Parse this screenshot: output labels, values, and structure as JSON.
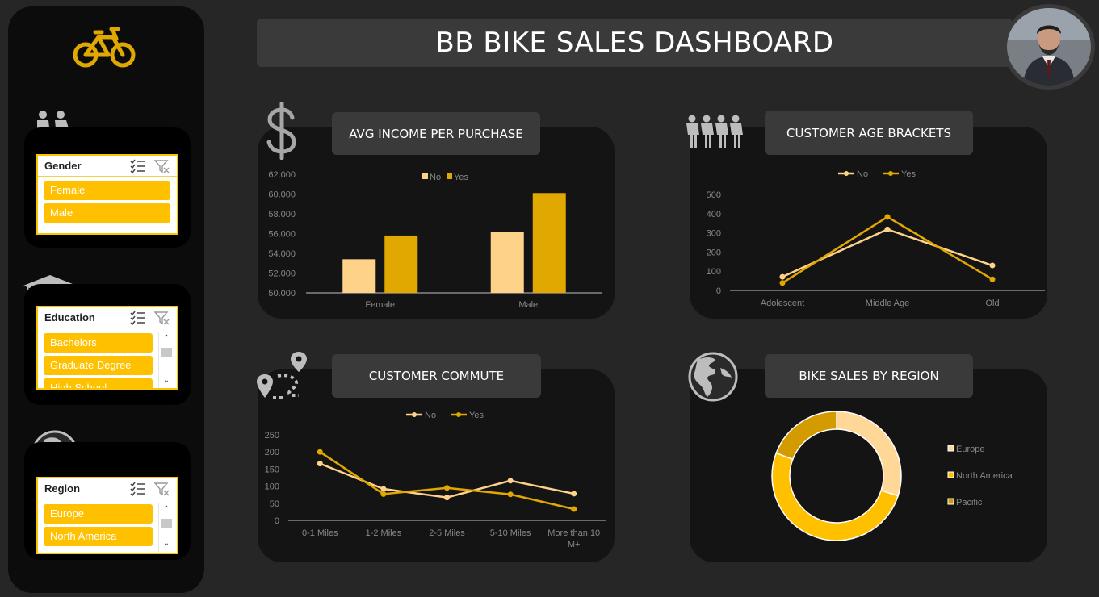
{
  "dashboard": {
    "title": "BB BIKE SALES DASHBOARD"
  },
  "icons": {
    "logo": "bicycle-icon",
    "gender": "people-couple-icon",
    "education": "graduation-cap-icon",
    "region": "globe-africa-icon",
    "income": "dollar-icon",
    "age": "group-people-icon",
    "commute": "route-pins-icon",
    "region_chart": "globe-americas-icon",
    "multi_select": "multi-select-icon",
    "clear_filter": "clear-filter-icon",
    "avatar": "user-avatar"
  },
  "colors": {
    "accent": "#ffc000",
    "no_series": "#ffd28a",
    "yes_series": "#e0a800",
    "background": "#262626",
    "panel": "#141414"
  },
  "slicers": {
    "gender": {
      "header": "Gender",
      "items": [
        "Female",
        "Male"
      ]
    },
    "education": {
      "header": "Education",
      "items": [
        "Bachelors",
        "Graduate Degree",
        "High School"
      ]
    },
    "region": {
      "header": "Region",
      "items": [
        "Europe",
        "North America"
      ]
    }
  },
  "chart_data": [
    {
      "type": "bar",
      "title": "AVG INCOME PER PURCHASE",
      "categories": [
        "Female",
        "Male"
      ],
      "series": [
        {
          "name": "No",
          "values": [
            53400,
            56200
          ]
        },
        {
          "name": "Yes",
          "values": [
            55800,
            60100
          ]
        }
      ],
      "ylim": [
        50000,
        62000
      ],
      "yticks": [
        "50.000",
        "52.000",
        "54.000",
        "56.000",
        "58.000",
        "60.000",
        "62.000"
      ],
      "legend": "top",
      "grid": false
    },
    {
      "type": "line",
      "title": "CUSTOMER AGE BRACKETS",
      "categories": [
        "Adolescent",
        "Middle Age",
        "Old"
      ],
      "series": [
        {
          "name": "No",
          "values": [
            71,
            318,
            130
          ]
        },
        {
          "name": "Yes",
          "values": [
            39,
            383,
            58
          ]
        }
      ],
      "ylim": [
        0,
        500
      ],
      "yticks": [
        "0",
        "100",
        "200",
        "300",
        "400",
        "500"
      ],
      "legend": "top",
      "grid": false
    },
    {
      "type": "line",
      "title": "CUSTOMER COMMUTE",
      "categories": [
        "0-1 Miles",
        "1-2 Miles",
        "2-5 Miles",
        "5-10 Miles",
        "More than 10 M+"
      ],
      "series": [
        {
          "name": "No",
          "values": [
            166,
            92,
            67,
            116,
            78
          ]
        },
        {
          "name": "Yes",
          "values": [
            200,
            77,
            95,
            76,
            33
          ]
        }
      ],
      "ylim": [
        0,
        250
      ],
      "yticks": [
        "0",
        "50",
        "100",
        "150",
        "200",
        "250"
      ],
      "legend": "top",
      "grid": false
    },
    {
      "type": "pie",
      "title": "BIKE SALES BY REGION",
      "categories": [
        "Europe",
        "North America",
        "Pacific"
      ],
      "values": [
        300,
        508,
        192
      ],
      "colors": [
        "#ffd898",
        "#ffc000",
        "#d49b00"
      ],
      "legend": "right",
      "donut": true
    }
  ]
}
